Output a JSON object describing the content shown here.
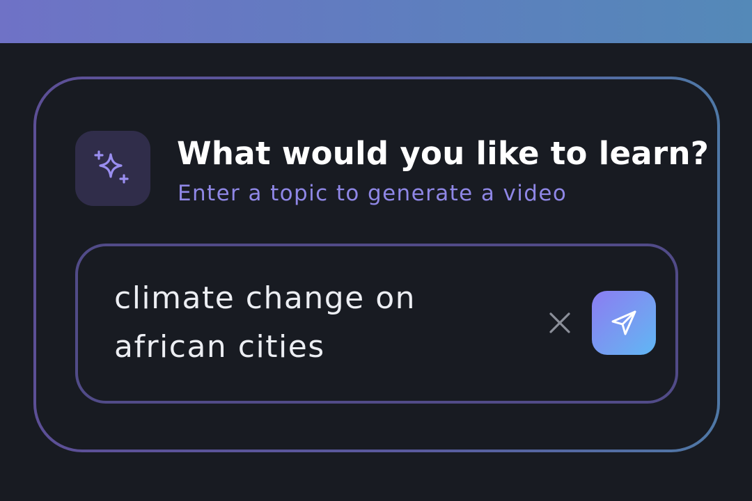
{
  "prompt_card": {
    "title": "What would you like to learn?",
    "subtitle": "Enter a topic to generate a video",
    "header_icon": "sparkles-icon",
    "topic_input": {
      "value": "climate change on african cities",
      "clear_icon": "close-icon",
      "send_icon": "send-icon"
    }
  },
  "colors": {
    "accent_purple": "#8f87e6",
    "background": "#181b22",
    "icon_tile": "#302d4a",
    "send_gradient_start": "#8b7cf3",
    "send_gradient_end": "#5fb7f5"
  }
}
